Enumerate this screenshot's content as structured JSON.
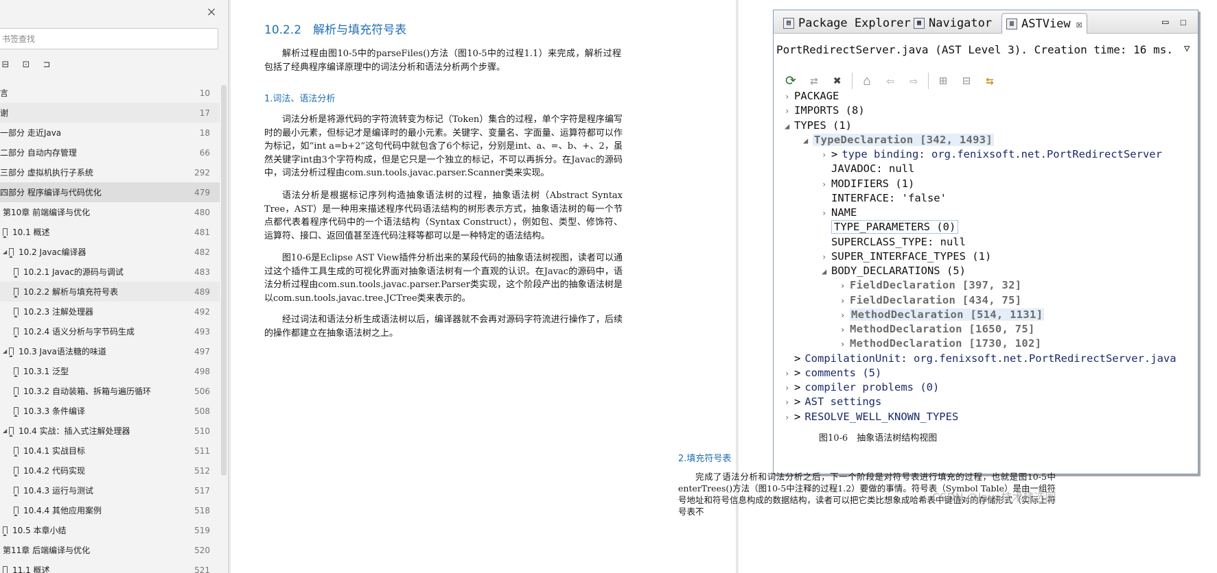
{
  "sidebar": {
    "close": "×",
    "search_placeholder": "书签查找",
    "tools": [
      "⊟",
      "⊡",
      "⊐"
    ],
    "items": [
      {
        "label": "言",
        "page": "10",
        "level": 0
      },
      {
        "label": "谢",
        "page": "17",
        "level": 0,
        "state": "hover"
      },
      {
        "label": "一部分 走近Java",
        "page": "18",
        "level": 0
      },
      {
        "label": "二部分 自动内存管理",
        "page": "66",
        "level": 0
      },
      {
        "label": "三部分 虚拟机执行子系统",
        "page": "292",
        "level": 0
      },
      {
        "label": "四部分 程序编译与代码优化",
        "page": "479",
        "level": 0,
        "state": "selected"
      },
      {
        "label": "第10章 前端编译与优化",
        "page": "480",
        "level": 1
      },
      {
        "label": "10.1 概述",
        "page": "481",
        "level": 2
      },
      {
        "label": "10.2 Javac编译器",
        "page": "482",
        "level": 2,
        "tri": true
      },
      {
        "label": "10.2.1 Javac的源码与调试",
        "page": "483",
        "level": 3
      },
      {
        "label": "10.2.2 解析与填充符号表",
        "page": "489",
        "level": 3,
        "state": "hover"
      },
      {
        "label": "10.2.3 注解处理器",
        "page": "492",
        "level": 3
      },
      {
        "label": "10.2.4 语义分析与字节码生成",
        "page": "493",
        "level": 3
      },
      {
        "label": "10.3 Java语法糖的味道",
        "page": "497",
        "level": 2,
        "tri": true
      },
      {
        "label": "10.3.1 泛型",
        "page": "498",
        "level": 3
      },
      {
        "label": "10.3.2 自动装箱、拆箱与遍历循环",
        "page": "506",
        "level": 3
      },
      {
        "label": "10.3.3 条件编译",
        "page": "508",
        "level": 3
      },
      {
        "label": "10.4 实战：插入式注解处理器",
        "page": "510",
        "level": 2,
        "tri": true
      },
      {
        "label": "10.4.1 实战目标",
        "page": "511",
        "level": 3
      },
      {
        "label": "10.4.2 代码实现",
        "page": "512",
        "level": 3
      },
      {
        "label": "10.4.3 运行与测试",
        "page": "517",
        "level": 3
      },
      {
        "label": "10.4.4 其他应用案例",
        "page": "518",
        "level": 3
      },
      {
        "label": "10.5 本章小结",
        "page": "519",
        "level": 2
      },
      {
        "label": "第11章 后端编译与优化",
        "page": "520",
        "level": 1
      },
      {
        "label": "11.1 概述",
        "page": "521",
        "level": 2
      }
    ]
  },
  "left_page": {
    "heading": "10.2.2　解析与填充符号表",
    "intro": "解析过程由图10-5中的parseFiles()方法（图10-5中的过程1.1）来完成，解析过程包括了经典程序编译原理中的词法分析和语法分析两个步骤。",
    "sub1": "1.词法、语法分析",
    "p1": "词法分析是将源代码的字符流转变为标记（Token）集合的过程，单个字符是程序编写时的最小元素，但标记才是编译时的最小元素。关键字、变量名、字面量、运算符都可以作为标记，如“int a=b+2”这句代码中就包含了6个标记，分别是int、a、=、b、+、2，虽然关键字int由3个字符构成，但是它只是一个独立的标记，不可以再拆分。在Javac的源码中，词法分析过程由com.sun.tools.javac.parser.Scanner类来实现。",
    "p2": "语法分析是根据标记序列构造抽象语法树的过程，抽象语法树（Abstract Syntax Tree，AST）是一种用来描述程序代码语法结构的树形表示方式，抽象语法树的每一个节点都代表着程序代码中的一个语法结构（Syntax Construct），例如包、类型、修饰符、运算符、接口、返回值甚至连代码注释等都可以是一种特定的语法结构。",
    "p3": "图10-6是Eclipse AST View插件分析出来的某段代码的抽象语法树视图，读者可以通过这个插件工具生成的可视化界面对抽象语法树有一个直观的认识。在Javac的源码中，语法分析过程由com.sun.tools.javac.parser.Parser类实现，这个阶段产出的抽象语法树是以com.sun.tools.javac.tree.JCTree类来表示的。",
    "p4": "经过词法和语法分析生成语法树以后，编译器就不会再对源码字符流进行操作了，后续的操作都建立在抽象语法树之上。"
  },
  "figure": {
    "tabs": [
      "Package Explorer",
      "Navigator",
      "ASTView"
    ],
    "tab_close": "☒",
    "window_controls": [
      "▭",
      "☐"
    ],
    "info_line": "PortRedirectServer.java (AST Level 3).  Creation time: 16 ms.",
    "info_dropdown": "▽",
    "toolbar": [
      "⟳",
      "⇄",
      "✖",
      "⌂",
      "⇦",
      "⇨",
      "⊞",
      "⊟",
      "⇆"
    ],
    "tree": [
      {
        "indent": 0,
        "twisty": "›",
        "text": "PACKAGE"
      },
      {
        "indent": 0,
        "twisty": "›",
        "text": "IMPORTS (8)"
      },
      {
        "indent": 0,
        "twisty": "◢",
        "text": "TYPES (1)"
      },
      {
        "indent": 1,
        "twisty": "◢",
        "text": "TypeDeclaration [342, 1493]",
        "style": "grey hl"
      },
      {
        "indent": 2,
        "twisty": "›",
        "gt": ">",
        "text": "type binding: org.fenixsoft.net.PortRedirectServer",
        "style": "binding"
      },
      {
        "indent": 2,
        "twisty": "",
        "text": "JAVADOC: null"
      },
      {
        "indent": 2,
        "twisty": "›",
        "text": "MODIFIERS (1)"
      },
      {
        "indent": 2,
        "twisty": "",
        "text": "INTERFACE: 'false'"
      },
      {
        "indent": 2,
        "twisty": "›",
        "text": "NAME"
      },
      {
        "indent": 2,
        "twisty": "",
        "text": "TYPE_PARAMETERS (0)",
        "style": "box"
      },
      {
        "indent": 2,
        "twisty": "",
        "text": "SUPERCLASS_TYPE: null"
      },
      {
        "indent": 2,
        "twisty": "›",
        "text": "SUPER_INTERFACE_TYPES (1)"
      },
      {
        "indent": 2,
        "twisty": "◢",
        "text": "BODY_DECLARATIONS (5)"
      },
      {
        "indent": 3,
        "twisty": "›",
        "text": "FieldDeclaration [397, 32]",
        "style": "grey"
      },
      {
        "indent": 3,
        "twisty": "›",
        "text": "FieldDeclaration [434, 75]",
        "style": "grey"
      },
      {
        "indent": 3,
        "twisty": "›",
        "text": "MethodDeclaration [514, 1131]",
        "style": "grey hl"
      },
      {
        "indent": 3,
        "twisty": "›",
        "text": "MethodDeclaration [1650, 75]",
        "style": "grey"
      },
      {
        "indent": 3,
        "twisty": "›",
        "text": "MethodDeclaration [1730, 102]",
        "style": "grey"
      },
      {
        "indent": 0,
        "twisty": "",
        "gt": ">",
        "text": "CompilationUnit: org.fenixsoft.net.PortRedirectServer.java",
        "style": "binding"
      },
      {
        "indent": 0,
        "twisty": "›",
        "gt": ">",
        "text": "comments (5)",
        "style": "binding"
      },
      {
        "indent": 0,
        "twisty": "›",
        "gt": ">",
        "text": "compiler problems (0)",
        "style": "binding"
      },
      {
        "indent": 0,
        "twisty": "›",
        "gt": ">",
        "text": "AST settings",
        "style": "binding"
      },
      {
        "indent": 0,
        "twisty": "›",
        "gt": ">",
        "text": "RESOLVE_WELL_KNOWN_TYPES",
        "style": "binding"
      }
    ]
  },
  "right_page": {
    "caption": "图10-6　抽象语法树结构视图",
    "sub2": "2.填充符号表",
    "p5": "完成了语法分析和词法分析之后，下一个阶段是对符号表进行填充的过程，也就是图10-5中enterTrees()方法（图10-5中注释的过程1.2）要做的事情。符号表（Symbol Table）是由一组符号地址和符号信息构成的数据结构，读者可以把它类比想象成哈希表中键值对的存储形式（实际上符号表不",
    "watermark": "CSDN @Java技术精选圈"
  }
}
